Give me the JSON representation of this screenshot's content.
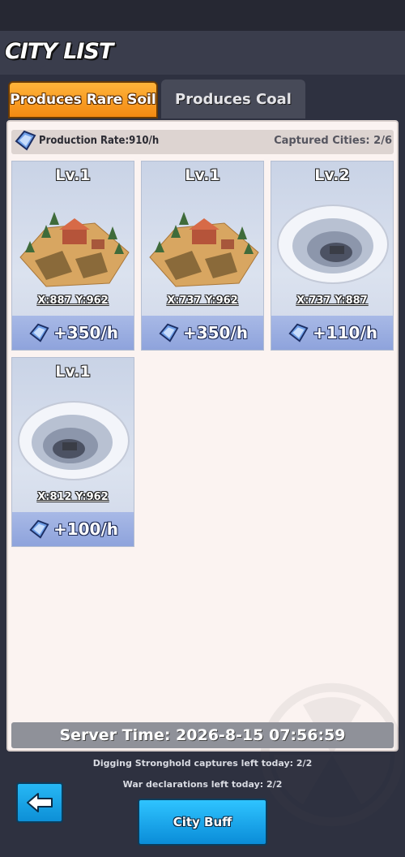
{
  "header": {
    "title": "CITY LIST"
  },
  "tabs": [
    {
      "label": "Produces Rare Soil",
      "active": true
    },
    {
      "label": "Produces Coal",
      "active": false
    }
  ],
  "summary": {
    "production_rate": "Production Rate:910/h",
    "captured": "Captured Cities: 2/6"
  },
  "cities": [
    {
      "level": "Lv.1",
      "coords": "X:887 Y:962",
      "production": "+350/h",
      "art": "farm-village"
    },
    {
      "level": "Lv.1",
      "coords": "X:737 Y:962",
      "production": "+350/h",
      "art": "farm-village"
    },
    {
      "level": "Lv.2",
      "coords": "X:737 Y:887",
      "production": "+110/h",
      "art": "snow-crater"
    },
    {
      "level": "Lv.1",
      "coords": "X:812 Y:962",
      "production": "+100/h",
      "art": "snow-crater"
    }
  ],
  "server_time": "Server Time: 2026-8-15 07:56:59",
  "info": {
    "stronghold": "Digging Stronghold captures left today: 2/2",
    "war": "War declarations left today: 2/2"
  },
  "buttons": {
    "city_buff": "City Buff"
  },
  "colors": {
    "accent_orange": "#f38a12",
    "button_blue": "#1aa6ec",
    "card_blue": "#8ea3dc"
  }
}
